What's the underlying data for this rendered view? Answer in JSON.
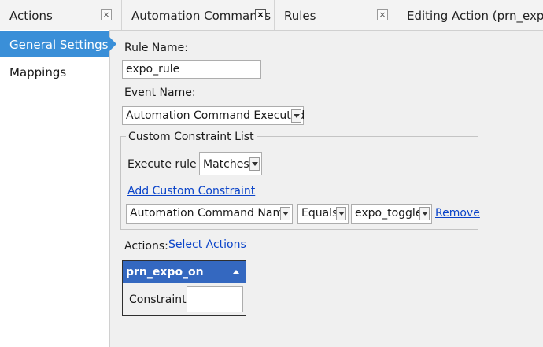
{
  "tabs": [
    {
      "label": "Actions"
    },
    {
      "label": "Automation Commands"
    },
    {
      "label": "Rules"
    },
    {
      "label": "Editing Action (prn_expo_on)"
    }
  ],
  "close_glyph": "×",
  "nav": {
    "items": [
      {
        "label": "General Settings"
      },
      {
        "label": "Mappings"
      }
    ]
  },
  "form": {
    "rule_name_label": "Rule Name:",
    "rule_name_value": "expo_rule",
    "event_name_label": "Event Name:",
    "event_name_value": "Automation Command Executed"
  },
  "constraints": {
    "group_title": "Custom Constraint List",
    "execute_label": "Execute rule if",
    "execute_value": "Matches",
    "add_link": "Add Custom Constraint",
    "row": {
      "field": "Automation Command Name",
      "operator": "Equals",
      "value": "expo_toggle",
      "remove": "Remove"
    }
  },
  "actions": {
    "label": "Actions:",
    "select_link": "Select Actions",
    "item": {
      "name": "prn_expo_on",
      "constraint_label": "Constraint:",
      "constraint_value": ""
    }
  },
  "colors": {
    "accent": "#3a8fd8",
    "action_header": "#3468c0",
    "link": "#0b44c9"
  }
}
